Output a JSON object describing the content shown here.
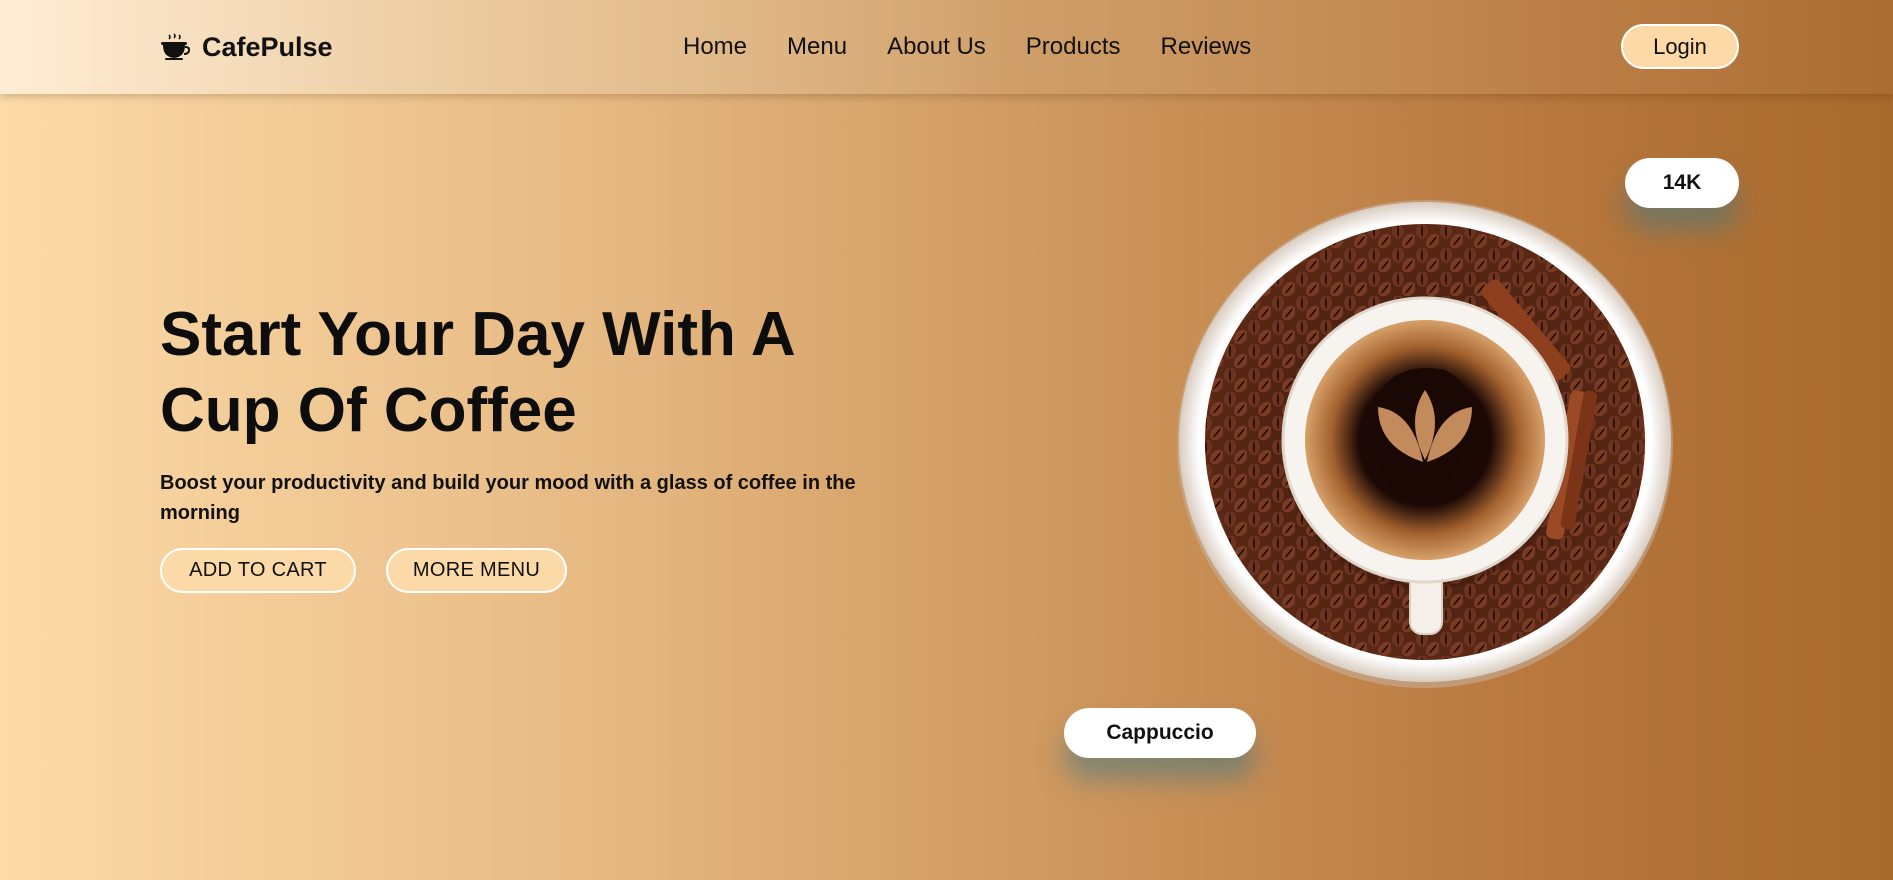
{
  "header": {
    "brand_name": "CafePulse",
    "brand_icon": "coffee-cup-icon",
    "nav": [
      "Home",
      "Menu",
      "About Us",
      "Products",
      "Reviews"
    ],
    "login_label": "Login"
  },
  "hero": {
    "title_line1": "Start Your Day With A",
    "title_line2": "Cup Of Coffee",
    "subtitle": "Boost your productivity and build your mood with a glass of coffee in the morning",
    "add_to_cart_label": "ADD TO CART",
    "more_menu_label": "MORE MENU"
  },
  "badges": {
    "count": "14K",
    "product_name": "Cappuccio"
  },
  "colors": {
    "accent_button": "#fcdaa8",
    "gradient_start": "#fcdba8",
    "gradient_end": "#a8692c"
  }
}
